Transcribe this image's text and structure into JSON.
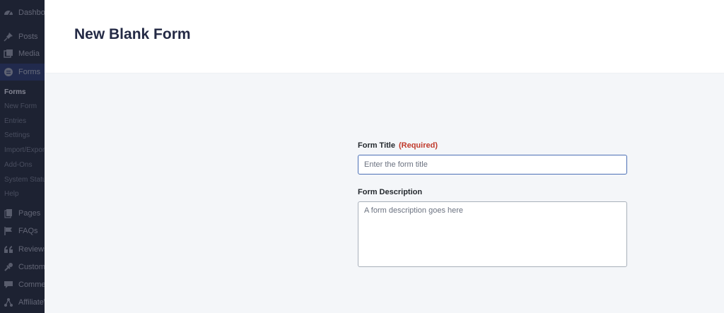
{
  "sidebar": {
    "items": [
      {
        "label": "Dashboard",
        "icon": "dashboard-icon"
      },
      {
        "label": "Posts",
        "icon": "pin-icon"
      },
      {
        "label": "Media",
        "icon": "media-icon"
      },
      {
        "label": "Forms",
        "icon": "forms-icon"
      },
      {
        "label": "Pages",
        "icon": "pages-icon"
      },
      {
        "label": "FAQs",
        "icon": "flag-icon"
      },
      {
        "label": "Reviews",
        "icon": "quote-icon"
      },
      {
        "label": "Customers",
        "icon": "customers-icon"
      },
      {
        "label": "Comments",
        "icon": "comments-icon"
      },
      {
        "label": "AffiliateWP",
        "icon": "affiliate-icon"
      }
    ],
    "submenu": [
      {
        "label": "Forms"
      },
      {
        "label": "New Form"
      },
      {
        "label": "Entries"
      },
      {
        "label": "Settings"
      },
      {
        "label": "Import/Export"
      },
      {
        "label": "Add-Ons"
      },
      {
        "label": "System Status"
      },
      {
        "label": "Help"
      }
    ]
  },
  "header": {
    "title": "New Blank Form"
  },
  "form": {
    "title_label": "Form Title",
    "title_required": "(Required)",
    "title_placeholder": "Enter the form title",
    "title_value": "",
    "description_label": "Form Description",
    "description_placeholder": "A form description goes here",
    "description_value": ""
  },
  "colors": {
    "accent": "#4b6fb5",
    "required": "#c0392b",
    "sidebar_bg": "#23282d",
    "title": "#242a45"
  }
}
